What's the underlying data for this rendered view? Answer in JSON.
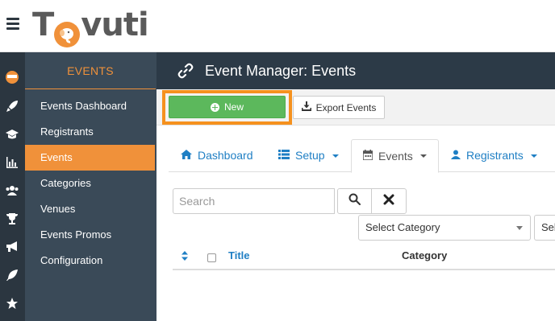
{
  "app": {
    "logo_text_left": "T",
    "logo_text_right": "vuti"
  },
  "sidebar": {
    "title": "EVENTS",
    "items": [
      {
        "label": "Events Dashboard",
        "active": false
      },
      {
        "label": "Registrants",
        "active": false
      },
      {
        "label": "Events",
        "active": true
      },
      {
        "label": "Categories",
        "active": false
      },
      {
        "label": "Venues",
        "active": false
      },
      {
        "label": "Events Promos",
        "active": false
      },
      {
        "label": "Configuration",
        "active": false
      }
    ]
  },
  "rail_icons": [
    "user-avatar-icon",
    "rocket-icon",
    "graduation-cap-icon",
    "bar-chart-icon",
    "users-icon",
    "trophy-icon",
    "bullhorn-icon",
    "feather-icon",
    "star-icon"
  ],
  "header": {
    "title": "Event Manager: Events"
  },
  "toolbar": {
    "new_label": "New",
    "export_label": "Export Events"
  },
  "tabs": [
    {
      "label": "Dashboard",
      "icon": "home-icon",
      "dropdown": false
    },
    {
      "label": "Setup",
      "icon": "list-icon",
      "dropdown": true
    },
    {
      "label": "Events",
      "icon": "calendar-icon",
      "dropdown": true,
      "active": true
    },
    {
      "label": "Registrants",
      "icon": "user-icon",
      "dropdown": true
    }
  ],
  "search": {
    "placeholder": "Search"
  },
  "filters": {
    "category_placeholder": "Select Category",
    "second_placeholder": "Sel"
  },
  "table": {
    "columns": [
      "Title",
      "Category"
    ]
  },
  "colors": {
    "accent": "#f0913a",
    "highlight_border": "#f5911e",
    "primary_button": "#5cb85c",
    "link": "#1f7fc4",
    "sidebar_bg": "#3a4a58",
    "titlebar_bg": "#2c3a47"
  }
}
